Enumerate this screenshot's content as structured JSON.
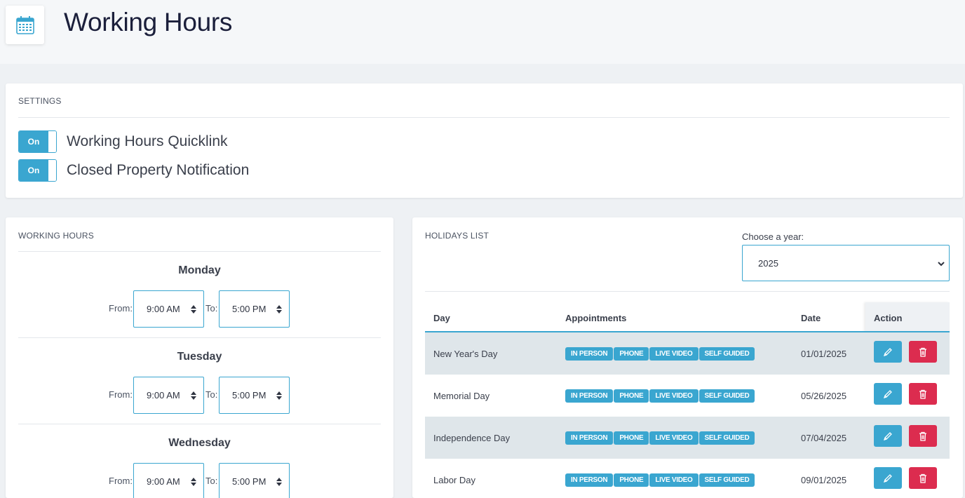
{
  "header": {
    "title": "Working Hours",
    "icon": "calendar-icon"
  },
  "settings": {
    "title": "SETTINGS",
    "toggles": [
      {
        "state": "On",
        "label": "Working Hours Quicklink"
      },
      {
        "state": "On",
        "label": "Closed Property Notification"
      }
    ]
  },
  "working_hours": {
    "title": "WORKING HOURS",
    "from_label": "From:",
    "to_label": "To:",
    "days": [
      {
        "name": "Monday",
        "from": "9:00 AM",
        "to": "5:00 PM"
      },
      {
        "name": "Tuesday",
        "from": "9:00 AM",
        "to": "5:00 PM"
      },
      {
        "name": "Wednesday",
        "from": "9:00 AM",
        "to": "5:00 PM"
      }
    ]
  },
  "holidays": {
    "title": "HOLIDAYS LIST",
    "year_label": "Choose a year:",
    "year": "2025",
    "columns": {
      "day": "Day",
      "appointments": "Appointments",
      "date": "Date",
      "action": "Action"
    },
    "badges": [
      "IN PERSON",
      "PHONE",
      "LIVE VIDEO",
      "SELF GUIDED"
    ],
    "rows": [
      {
        "day": "New Year's Day",
        "date": "01/01/2025"
      },
      {
        "day": "Memorial Day",
        "date": "05/26/2025"
      },
      {
        "day": "Independence Day",
        "date": "07/04/2025"
      },
      {
        "day": "Labor Day",
        "date": "09/01/2025"
      }
    ]
  },
  "colors": {
    "accent": "#3aa6d0",
    "danger": "#dc2c4f",
    "row_shade": "#dfe6ea"
  }
}
